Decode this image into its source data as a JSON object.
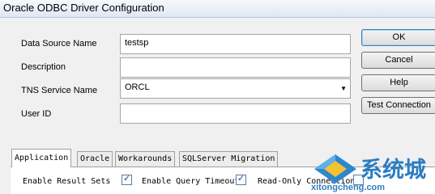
{
  "window": {
    "title": "Oracle ODBC Driver Configuration"
  },
  "form": {
    "data_source_name": {
      "label": "Data Source Name",
      "value": "testsp"
    },
    "description": {
      "label": "Description",
      "value": ""
    },
    "tns_service_name": {
      "label": "TNS Service Name",
      "value": "ORCL"
    },
    "user_id": {
      "label": "User ID",
      "value": ""
    }
  },
  "buttons": {
    "ok": "OK",
    "cancel": "Cancel",
    "help": "Help",
    "test_connection": "Test Connection"
  },
  "tabs": [
    "Application",
    "Oracle",
    "Workarounds",
    "SQLServer Migration"
  ],
  "options": {
    "enable_result_sets": {
      "label": "Enable Result Sets",
      "checked": true
    },
    "enable_query_timeout": {
      "label": "Enable Query Timeout",
      "checked": true
    },
    "read_only_connection": {
      "label": "Read-Only Connection",
      "checked": false
    }
  },
  "watermark": {
    "brand_cn": "系统城",
    "url": "xitongcheng.com"
  }
}
